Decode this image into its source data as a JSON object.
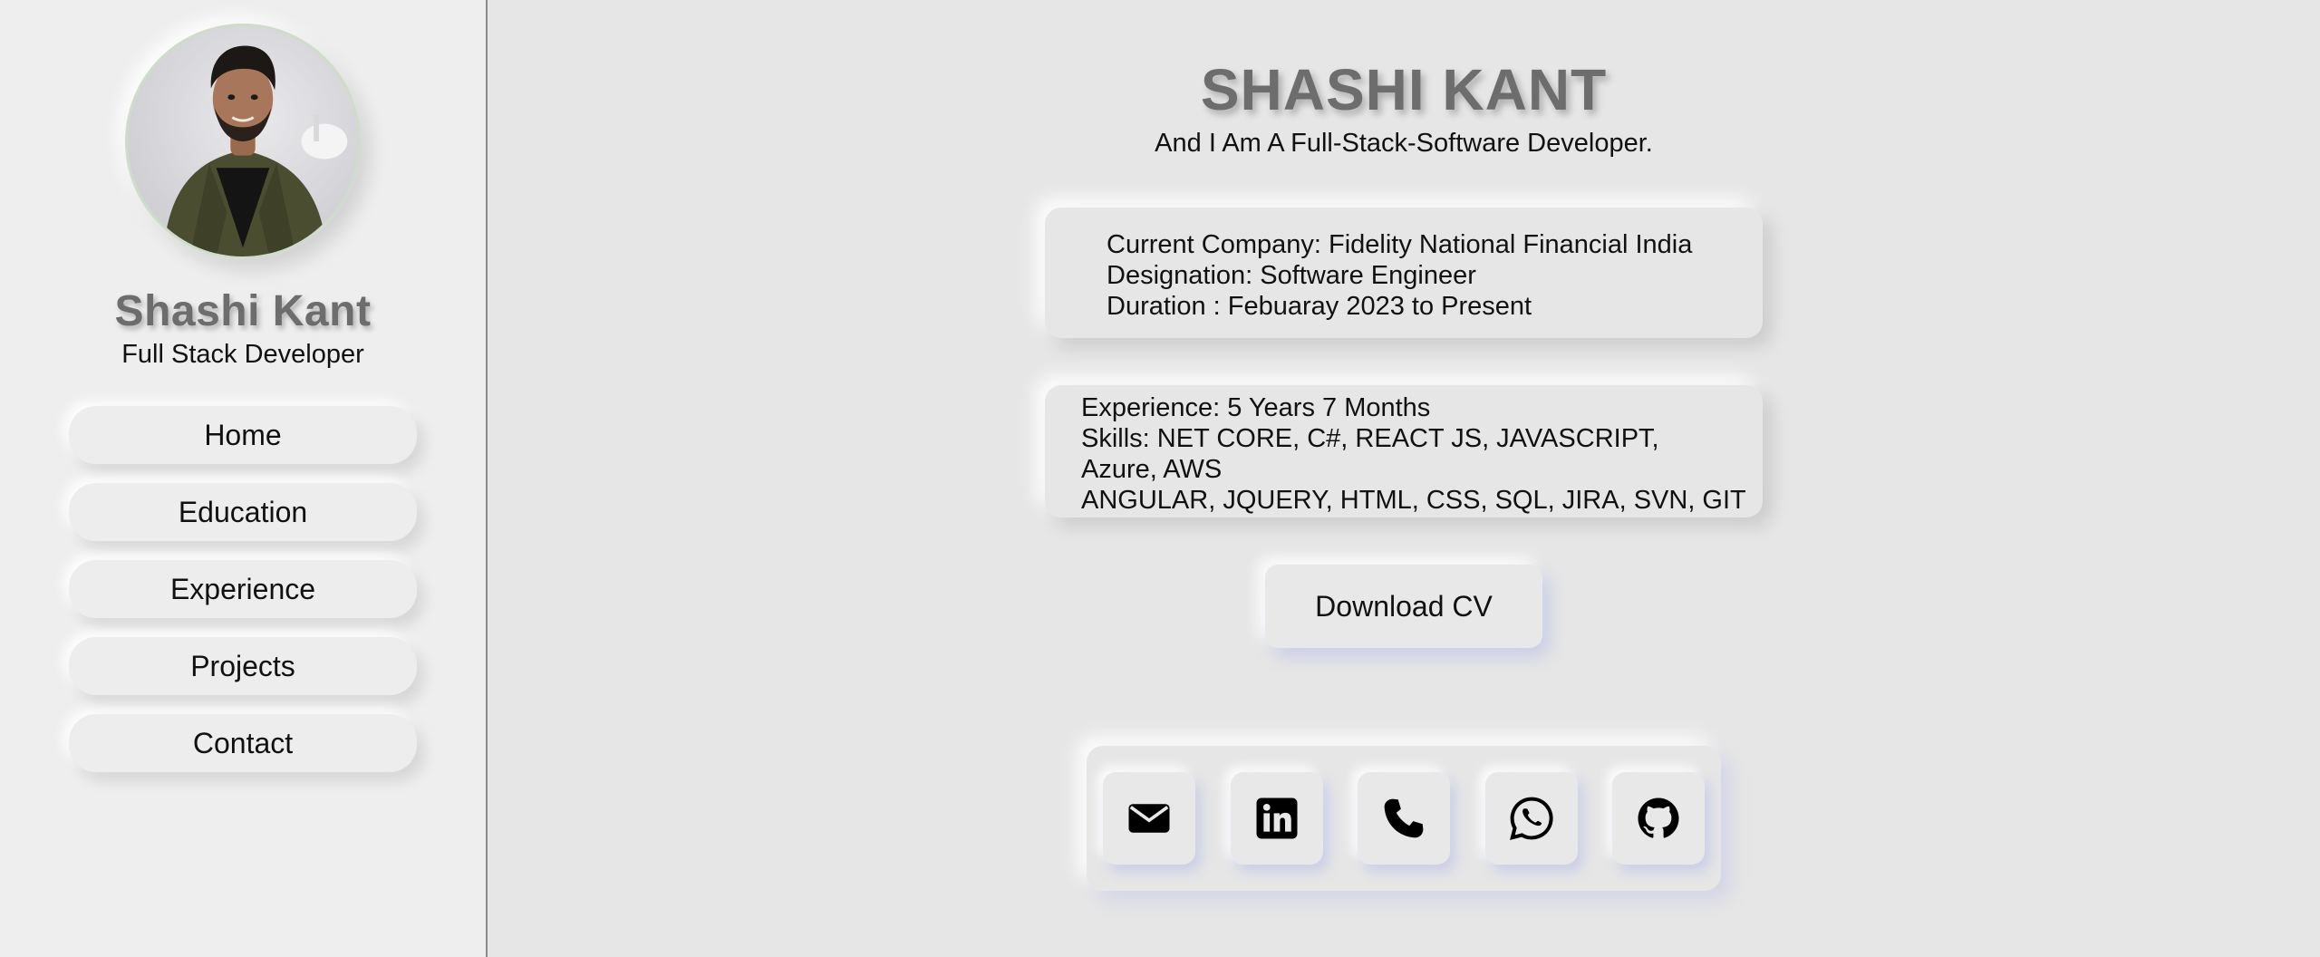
{
  "sidebar": {
    "name": "Shashi Kant",
    "role": "Full Stack Developer",
    "nav": [
      {
        "label": "Home"
      },
      {
        "label": "Education"
      },
      {
        "label": "Experience"
      },
      {
        "label": "Projects"
      },
      {
        "label": "Contact"
      }
    ]
  },
  "main": {
    "title": "SHASHI KANT",
    "subtitle": "And I Am A Full-Stack-Software Developer.",
    "company_card": {
      "company": "Current Company: Fidelity National Financial India",
      "designation": "Designation: Software Engineer",
      "duration": "Duration : Febuaray 2023 to Present"
    },
    "skills_card": {
      "experience": "Experience: 5 Years 7 Months",
      "skills_line1": "Skills: NET CORE, C#, REACT JS, JAVASCRIPT,",
      "skills_line2": "Azure, AWS",
      "skills_line3": "ANGULAR, JQUERY, HTML, CSS, SQL, JIRA, SVN, GIT"
    },
    "download_label": "Download CV",
    "social_icons": [
      "envelope-icon",
      "linkedin-icon",
      "phone-icon",
      "whatsapp-icon",
      "github-icon"
    ]
  }
}
